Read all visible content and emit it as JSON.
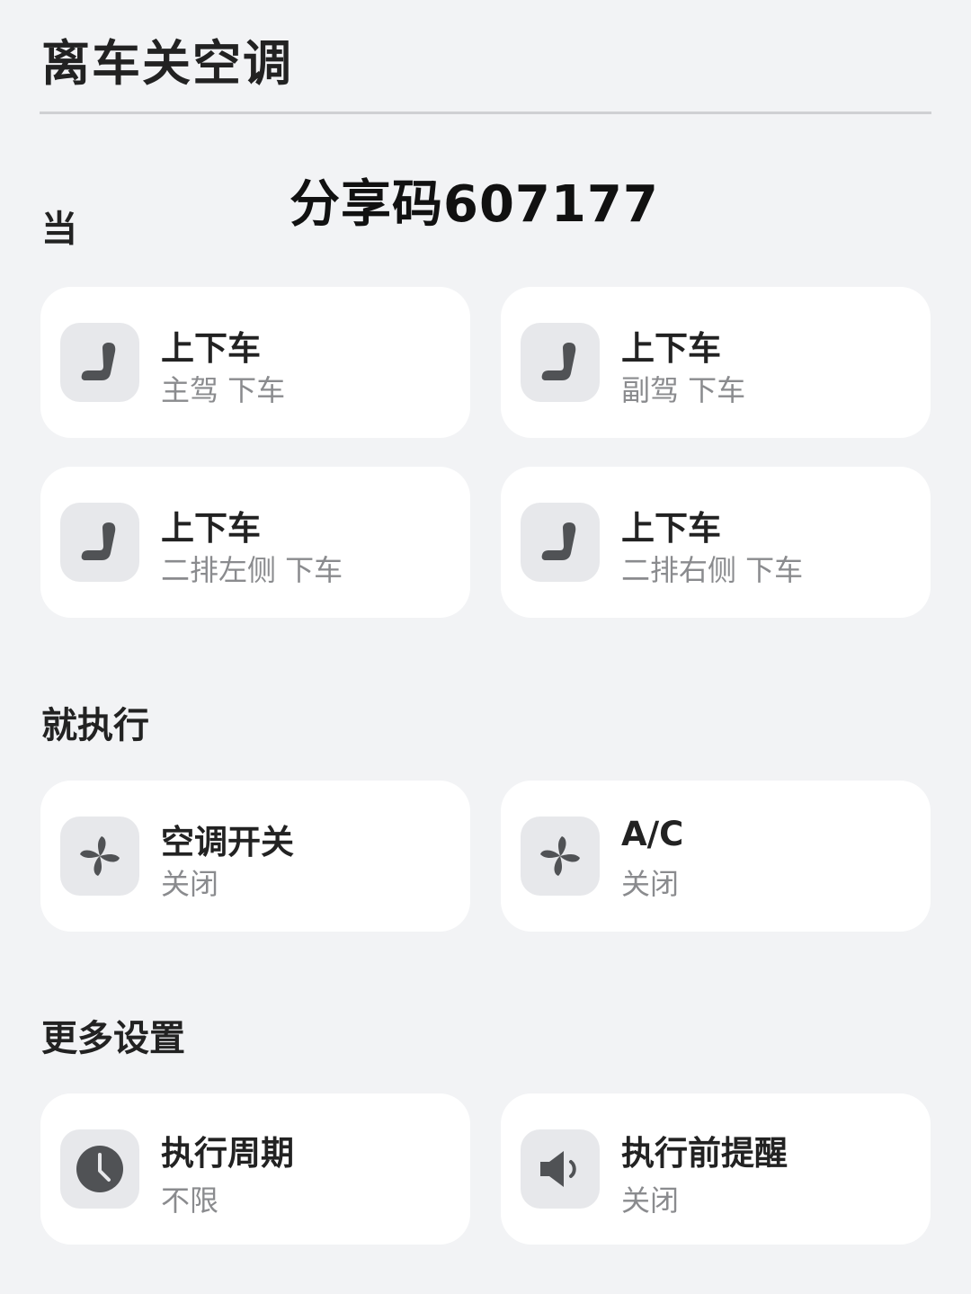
{
  "page": {
    "title": "离车关空调",
    "share_code": "分享码607177"
  },
  "sections": {
    "when_label": "当",
    "do_label": "就执行",
    "more_label": "更多设置"
  },
  "triggers": [
    {
      "title": "上下车",
      "subtitle": "主驾 下车",
      "icon": "seat-icon"
    },
    {
      "title": "上下车",
      "subtitle": "副驾 下车",
      "icon": "seat-icon"
    },
    {
      "title": "上下车",
      "subtitle": "二排左侧 下车",
      "icon": "seat-icon"
    },
    {
      "title": "上下车",
      "subtitle": "二排右侧 下车",
      "icon": "seat-icon"
    }
  ],
  "actions": [
    {
      "title": "空调开关",
      "subtitle": "关闭",
      "icon": "fan-icon"
    },
    {
      "title": "A/C",
      "subtitle": "关闭",
      "icon": "fan-icon"
    }
  ],
  "settings": [
    {
      "title": "执行周期",
      "subtitle": "不限",
      "icon": "clock-icon"
    },
    {
      "title": "执行前提醒",
      "subtitle": "关闭",
      "icon": "speaker-icon"
    }
  ],
  "colors": {
    "background": "#f2f3f5",
    "card": "#ffffff",
    "icon_tile": "#e7e8eb",
    "icon": "#505255",
    "subtitle": "#8a8b8e"
  }
}
